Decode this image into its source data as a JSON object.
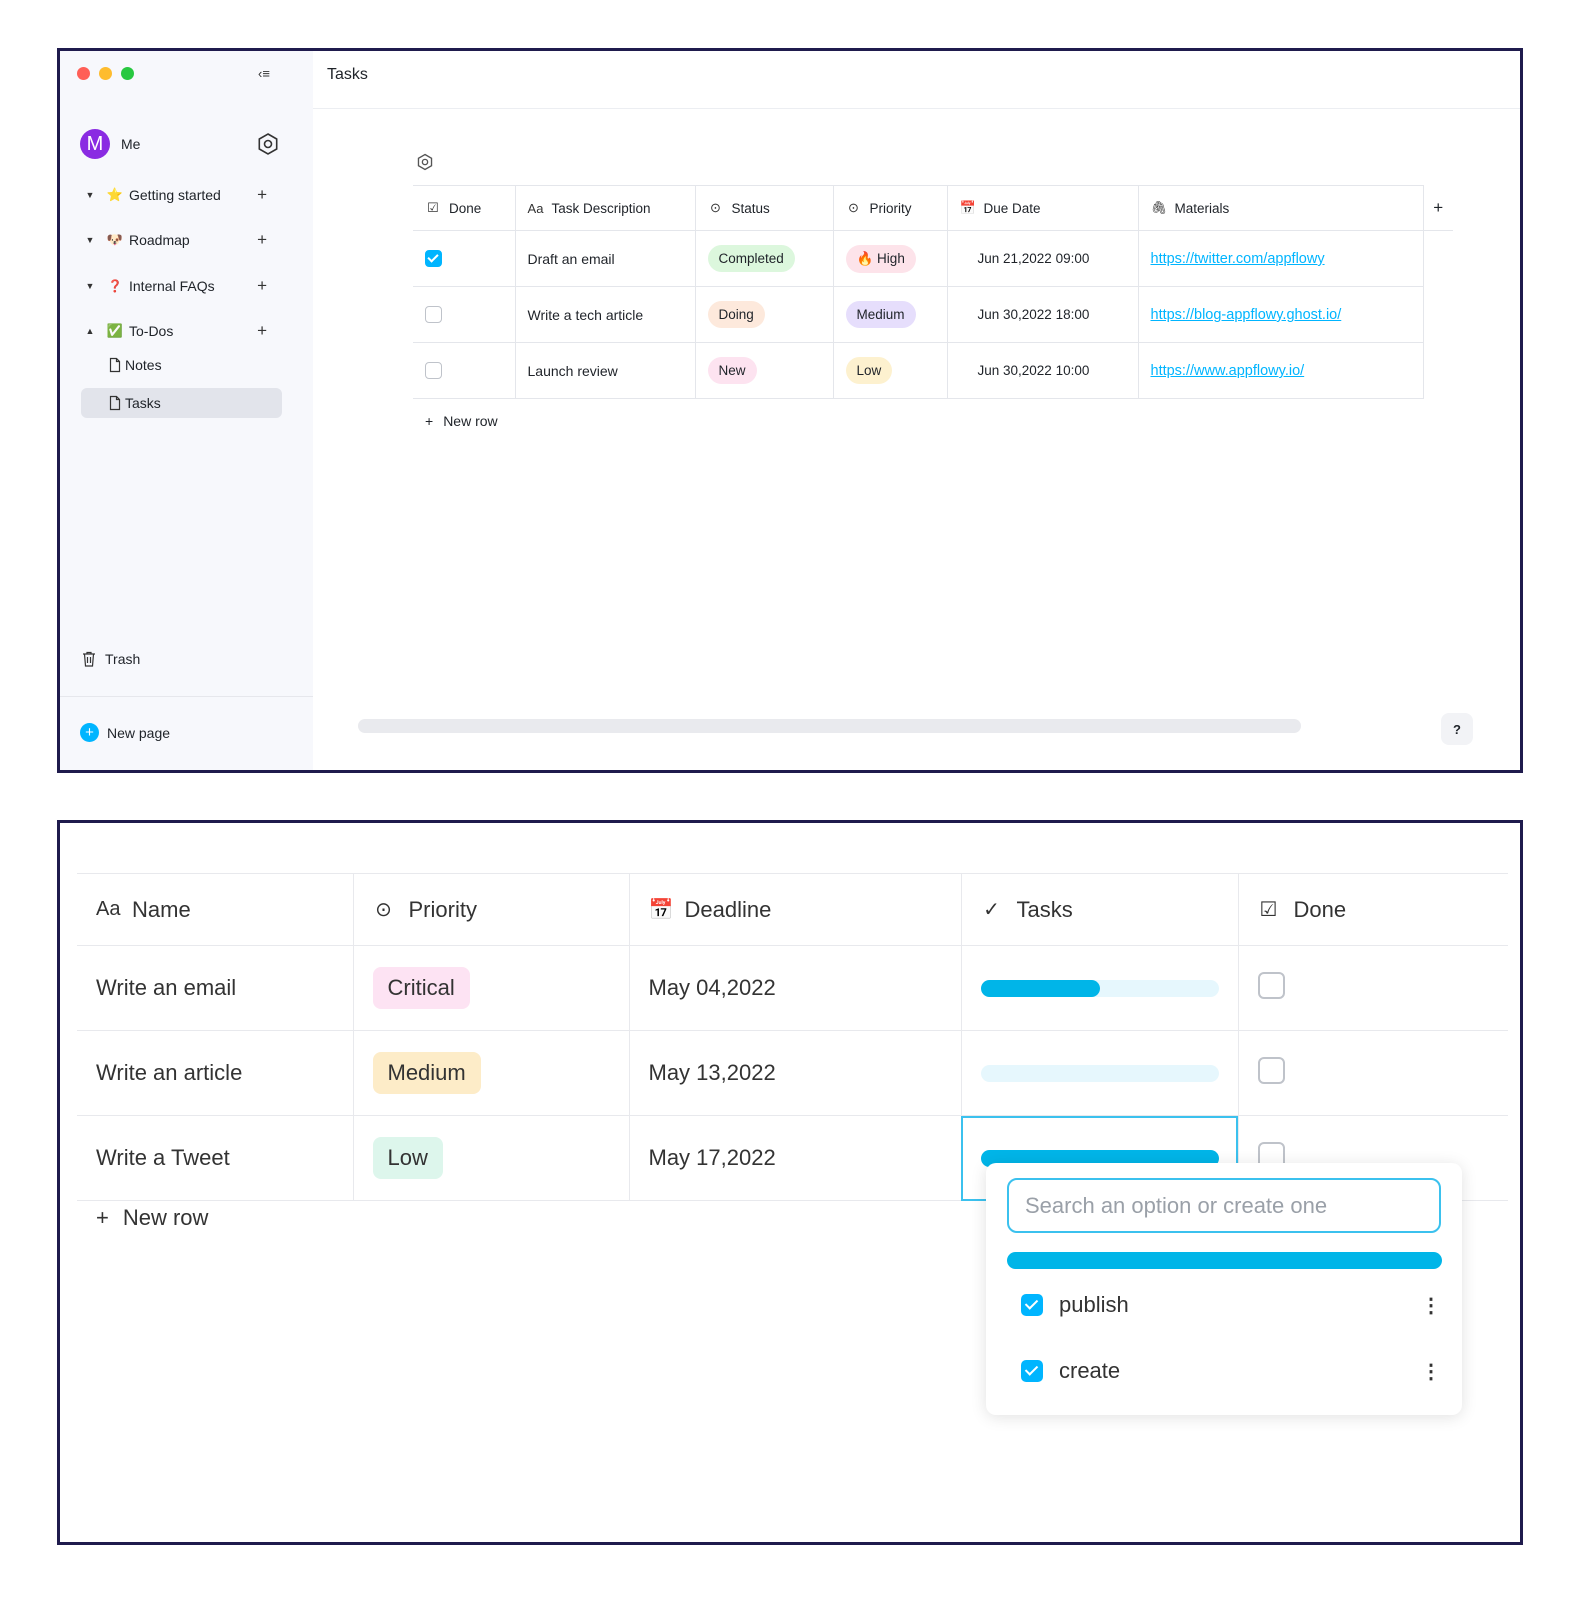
{
  "colors": {
    "accent": "#00b5ff",
    "frame": "#1f1b4d",
    "traffic": [
      "#ff5f57",
      "#febc2e",
      "#28c840"
    ]
  },
  "top": {
    "sidebar": {
      "user": {
        "avatar_letter": "M",
        "name": "Me"
      },
      "items": [
        {
          "emoji": "⭐",
          "label": "Getting started",
          "plus": "+"
        },
        {
          "emoji": "🐶",
          "label": "Roadmap",
          "plus": "+"
        },
        {
          "emoji": "❓",
          "label": "Internal FAQs",
          "plus": "+"
        },
        {
          "emoji": "✅",
          "label": "To-Dos",
          "plus": "+"
        }
      ],
      "subitems": [
        {
          "label": "Notes"
        },
        {
          "label": "Tasks"
        }
      ],
      "trash": "Trash",
      "new_page": "New page"
    },
    "title": "Tasks",
    "table": {
      "headers": [
        {
          "icon": "☑",
          "label": "Done"
        },
        {
          "icon": "Aa",
          "label": "Task Description"
        },
        {
          "icon": "⊙",
          "label": "Status"
        },
        {
          "icon": "⊙",
          "label": "Priority"
        },
        {
          "icon": "📅",
          "label": "Due Date"
        },
        {
          "icon": "🖇",
          "label": "Materials"
        }
      ],
      "add_column": "+",
      "rows": [
        {
          "done": true,
          "task": "Draft an email",
          "status": "Completed",
          "priority": "🔥 High",
          "due": "Jun 21,2022  09:00",
          "link": "https://twitter.com/appflowy"
        },
        {
          "done": false,
          "task": "Write a tech article",
          "status": "Doing",
          "priority": "Medium",
          "due": "Jun 30,2022  18:00",
          "link": "https://blog-appflowy.ghost.io/"
        },
        {
          "done": false,
          "task": "Launch review",
          "status": "New",
          "priority": "Low",
          "due": "Jun 30,2022  10:00",
          "link": "https://www.appflowy.io/"
        }
      ],
      "new_row": "New row"
    },
    "help": "?"
  },
  "bottom": {
    "headers": [
      {
        "icon": "Aa",
        "label": "Name"
      },
      {
        "icon": "⊙",
        "label": "Priority"
      },
      {
        "icon": "📅",
        "label": "Deadline"
      },
      {
        "icon": "✓",
        "label": "Tasks"
      },
      {
        "icon": "☑",
        "label": "Done"
      }
    ],
    "rows": [
      {
        "name": "Write an email",
        "priority": "Critical",
        "deadline": "May 04,2022",
        "progress": 0.5,
        "done": false
      },
      {
        "name": "Write an article",
        "priority": "Medium",
        "deadline": "May 13,2022",
        "progress": 0.0,
        "done": false
      },
      {
        "name": "Write a Tweet",
        "priority": "Low",
        "deadline": "May 17,2022",
        "progress": 1.0,
        "done": false
      }
    ],
    "new_row": "New row",
    "popup": {
      "placeholder": "Search an option or create one",
      "progress": 1.0,
      "options": [
        {
          "label": "publish",
          "checked": true
        },
        {
          "label": "create",
          "checked": true
        }
      ]
    }
  }
}
